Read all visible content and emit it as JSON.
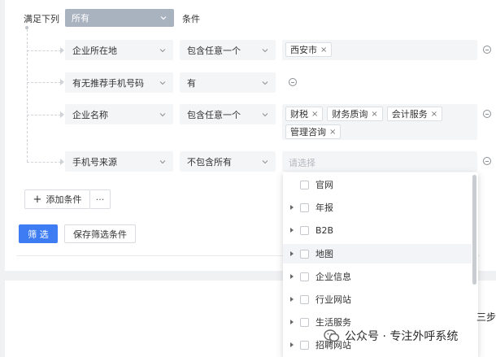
{
  "header": {
    "match_label": "满足下列",
    "match_value": "所有",
    "condition_label": "条件"
  },
  "conditions": [
    {
      "field": "企业所在地",
      "operator": "包含任意一个",
      "tags": [
        "西安市"
      ]
    },
    {
      "field": "有无推荐手机号码",
      "operator": "有",
      "tags": []
    },
    {
      "field": "企业名称",
      "operator": "包含任意一个",
      "tags": [
        "财税",
        "财务质询",
        "会计服务",
        "管理咨询"
      ]
    },
    {
      "field": "手机号来源",
      "operator": "不包含所有",
      "tags": [],
      "placeholder": "请选择"
    }
  ],
  "add_condition_label": "添加条件",
  "more_label": "···",
  "filter_button": "筛 选",
  "save_button": "保存筛选条件",
  "dropdown_options": [
    {
      "label": "官网",
      "expandable": false
    },
    {
      "label": "年报",
      "expandable": true
    },
    {
      "label": "B2B",
      "expandable": true
    },
    {
      "label": "地图",
      "expandable": true,
      "highlighted": true
    },
    {
      "label": "企业信息",
      "expandable": true
    },
    {
      "label": "行业网站",
      "expandable": true
    },
    {
      "label": "生活服务",
      "expandable": true
    },
    {
      "label": "招聘网站",
      "expandable": true
    }
  ],
  "side_text": "三步",
  "watermark": "公众号 · 专注外呼系统",
  "colors": {
    "primary": "#3d7cf2",
    "match_select_bg": "#a9b2bf",
    "field_bg": "#f4f5f7"
  }
}
